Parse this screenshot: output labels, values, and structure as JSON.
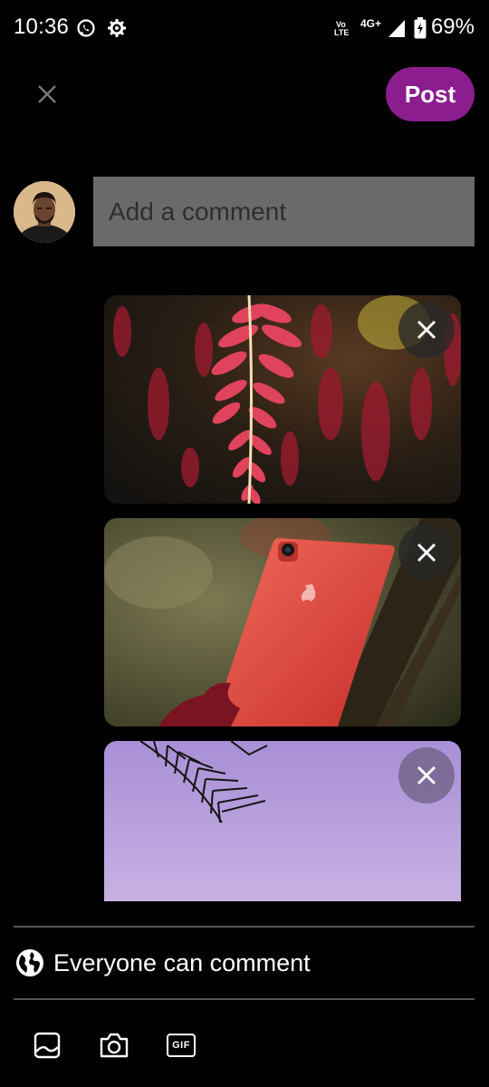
{
  "status_bar": {
    "time": "10:36",
    "volte_top": "Vo",
    "volte_bottom": "LTE",
    "network": "4G+",
    "battery": "69%",
    "icons": [
      "whatsapp-icon",
      "gear-icon",
      "signal-icon",
      "battery-icon"
    ]
  },
  "header": {
    "post_label": "Post",
    "close_icon": "close-icon",
    "accent": "#8b1d8f"
  },
  "composer": {
    "placeholder": "Add a comment",
    "value": ""
  },
  "media": [
    {
      "subject": "red hanging flowers",
      "remove_icon": "close-icon"
    },
    {
      "subject": "red phone on tree branch",
      "remove_icon": "close-icon"
    },
    {
      "subject": "palm leaf against purple sky",
      "remove_icon": "close-icon"
    }
  ],
  "audience": {
    "label": "Everyone can comment",
    "icon": "globe-icon"
  },
  "toolbar": {
    "items": [
      "image-icon",
      "camera-icon",
      "gif-icon"
    ],
    "gif_text": "GIF"
  }
}
